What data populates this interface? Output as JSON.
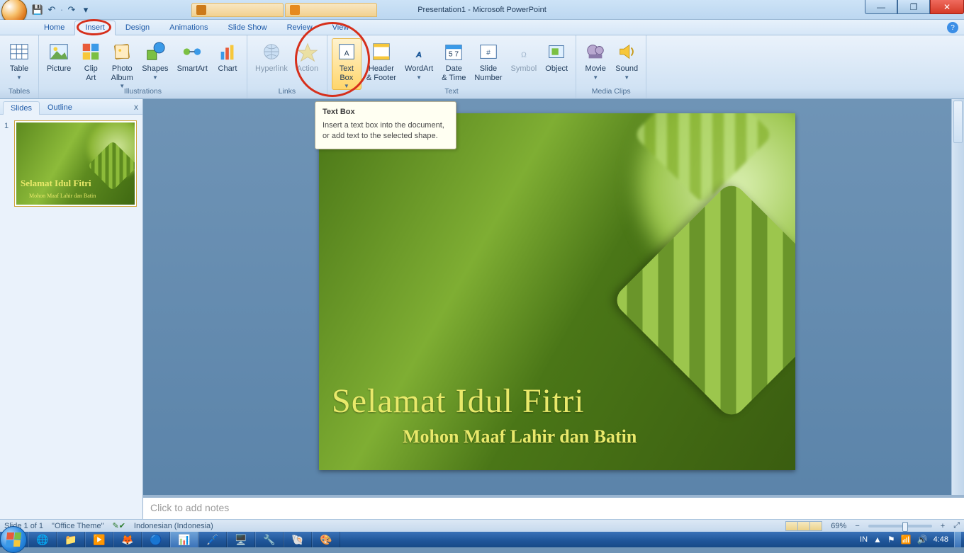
{
  "window": {
    "doc": "Presentation1",
    "app": "Microsoft PowerPoint",
    "center_label": "Presentation1 - Microsoft PowerPoint"
  },
  "qat": {
    "save": "💾",
    "undo": "↶",
    "redo": "↷",
    "more": "▾"
  },
  "browser_tabs": [
    {
      "label": ""
    },
    {
      "label": ""
    }
  ],
  "win_buttons": {
    "min": "—",
    "max": "❐",
    "close": "✕"
  },
  "ribbon_tabs": [
    "Home",
    "Insert",
    "Design",
    "Animations",
    "Slide Show",
    "Review",
    "View"
  ],
  "active_tab": "Insert",
  "help": "?",
  "groups": {
    "tables": {
      "label": "Tables",
      "items": [
        {
          "id": "table",
          "label": "Table",
          "dd": true
        }
      ]
    },
    "illustrations": {
      "label": "Illustrations",
      "items": [
        {
          "id": "picture",
          "label": "Picture"
        },
        {
          "id": "clipart",
          "label": "Clip\nArt"
        },
        {
          "id": "photoalbum",
          "label": "Photo\nAlbum",
          "dd": true
        },
        {
          "id": "shapes",
          "label": "Shapes",
          "dd": true
        },
        {
          "id": "smartart",
          "label": "SmartArt"
        },
        {
          "id": "chart",
          "label": "Chart"
        }
      ]
    },
    "links": {
      "label": "Links",
      "items": [
        {
          "id": "hyperlink",
          "label": "Hyperlink",
          "dis": true
        },
        {
          "id": "action",
          "label": "Action",
          "dis": true
        }
      ]
    },
    "text": {
      "label": "Text",
      "items": [
        {
          "id": "textbox",
          "label": "Text\nBox",
          "dd": true,
          "sel": true
        },
        {
          "id": "headerfooter",
          "label": "Header\n& Footer"
        },
        {
          "id": "wordart",
          "label": "WordArt",
          "dd": true
        },
        {
          "id": "datetime",
          "label": "Date\n& Time"
        },
        {
          "id": "slidenumber",
          "label": "Slide\nNumber"
        },
        {
          "id": "symbol",
          "label": "Symbol",
          "dis": true
        },
        {
          "id": "object",
          "label": "Object"
        }
      ]
    },
    "mediaclips": {
      "label": "Media Clips",
      "items": [
        {
          "id": "movie",
          "label": "Movie",
          "dd": true
        },
        {
          "id": "sound",
          "label": "Sound",
          "dd": true
        }
      ]
    }
  },
  "tooltip": {
    "title": "Text Box",
    "body": "Insert a text box into the document, or add text to the selected shape."
  },
  "sidepane": {
    "tabs": [
      "Slides",
      "Outline"
    ],
    "close": "x",
    "thumb_num": "1",
    "thumb_title": "Selamat Idul Fitri",
    "thumb_sub": "Mohon Maaf Lahir dan Batin"
  },
  "slide": {
    "title": "Selamat Idul Fitri",
    "subtitle": "Mohon Maaf Lahir dan Batin"
  },
  "notes_placeholder": "Click to add notes",
  "status": {
    "slide": "Slide 1 of 1",
    "theme": "\"Office Theme\"",
    "lang": "Indonesian (Indonesia)",
    "zoom": "69%",
    "fit": "⤢"
  },
  "tray": {
    "lang": "IN",
    "time": "4:48"
  }
}
